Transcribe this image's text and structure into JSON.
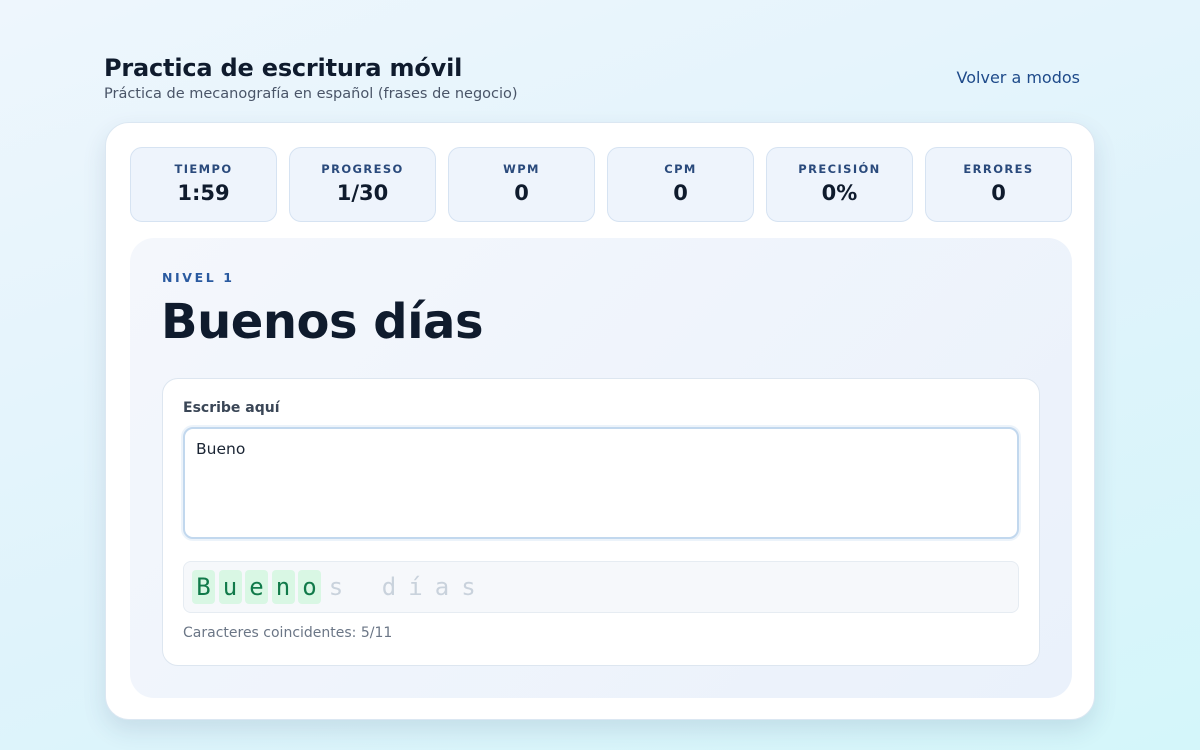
{
  "header": {
    "title": "Practica de escritura móvil",
    "subtitle": "Práctica de mecanografía en español (frases de negocio)",
    "back_link": "Volver a modos"
  },
  "stats": [
    {
      "label": "TIEMPO",
      "value": "1:59"
    },
    {
      "label": "PROGRESO",
      "value": "1/30"
    },
    {
      "label": "WPM",
      "value": "0"
    },
    {
      "label": "CPM",
      "value": "0"
    },
    {
      "label": "PRECISIÓN",
      "value": "0%"
    },
    {
      "label": "ERRORES",
      "value": "0"
    }
  ],
  "practice": {
    "level": "NIVEL 1",
    "phrase": "Buenos días",
    "input_label": "Escribe aquí",
    "input_value": "Bueno",
    "chars": [
      {
        "char": "B",
        "state": "ok"
      },
      {
        "char": "u",
        "state": "ok"
      },
      {
        "char": "e",
        "state": "ok"
      },
      {
        "char": "n",
        "state": "ok"
      },
      {
        "char": "o",
        "state": "ok"
      },
      {
        "char": "s",
        "state": "pending"
      },
      {
        "char": " ",
        "state": "pending"
      },
      {
        "char": "d",
        "state": "pending"
      },
      {
        "char": "í",
        "state": "pending"
      },
      {
        "char": "a",
        "state": "pending"
      },
      {
        "char": "s",
        "state": "pending"
      }
    ],
    "match_text": "Caracteres coincidentes: 5/11"
  },
  "colors": {
    "accent": "#1e4a8a",
    "char_ok_bg": "#d9f7e4",
    "char_ok_text": "#117a4a",
    "char_pending": "#c9d2dc"
  }
}
